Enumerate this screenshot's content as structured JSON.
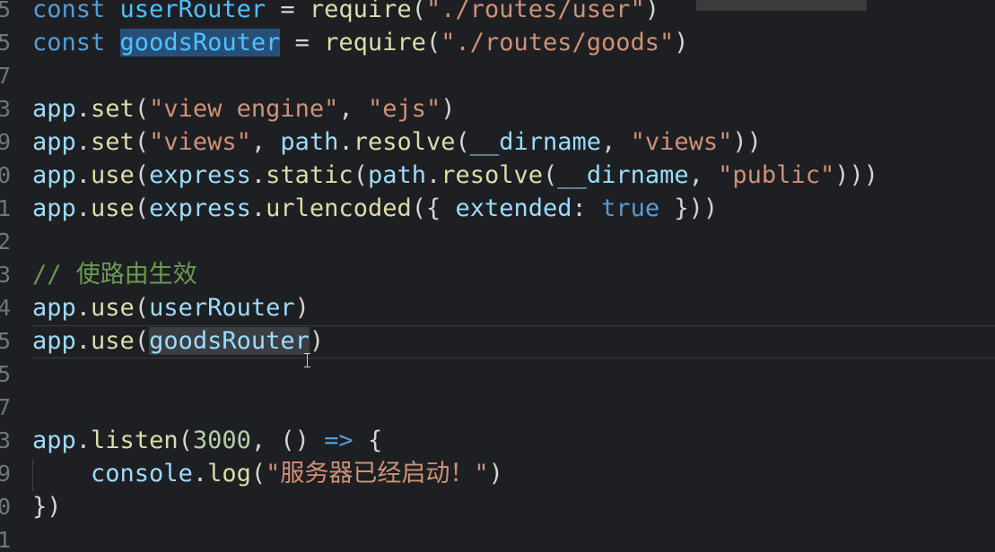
{
  "editor": {
    "gutter_numbers": [
      "5",
      "5",
      "7",
      "3",
      "9",
      "0",
      "1",
      "2",
      "3",
      "4",
      "5",
      "5",
      "7",
      "3",
      "9",
      "0",
      "1"
    ],
    "lines": [
      [
        {
          "t": "const ",
          "c": "kw"
        },
        {
          "t": "userRouter",
          "c": "var"
        },
        {
          "t": " = ",
          "c": "punc"
        },
        {
          "t": "require",
          "c": "fn"
        },
        {
          "t": "(",
          "c": "punc"
        },
        {
          "t": "\"./routes/user\"",
          "c": "str"
        },
        {
          "t": ")",
          "c": "punc"
        }
      ],
      [
        {
          "t": "const ",
          "c": "kw"
        },
        {
          "t": "goodsRouter",
          "c": "var hl-word"
        },
        {
          "t": " = ",
          "c": "punc"
        },
        {
          "t": "require",
          "c": "fn"
        },
        {
          "t": "(",
          "c": "punc"
        },
        {
          "t": "\"./routes/goods\"",
          "c": "str"
        },
        {
          "t": ")",
          "c": "punc"
        }
      ],
      [],
      [
        {
          "t": "app",
          "c": "obj"
        },
        {
          "t": ".",
          "c": "punc"
        },
        {
          "t": "set",
          "c": "fn"
        },
        {
          "t": "(",
          "c": "punc"
        },
        {
          "t": "\"view engine\"",
          "c": "str"
        },
        {
          "t": ", ",
          "c": "punc"
        },
        {
          "t": "\"ejs\"",
          "c": "str"
        },
        {
          "t": ")",
          "c": "punc"
        }
      ],
      [
        {
          "t": "app",
          "c": "obj"
        },
        {
          "t": ".",
          "c": "punc"
        },
        {
          "t": "set",
          "c": "fn"
        },
        {
          "t": "(",
          "c": "punc"
        },
        {
          "t": "\"views\"",
          "c": "str"
        },
        {
          "t": ", ",
          "c": "punc"
        },
        {
          "t": "path",
          "c": "obj"
        },
        {
          "t": ".",
          "c": "punc"
        },
        {
          "t": "resolve",
          "c": "fn"
        },
        {
          "t": "(",
          "c": "punc"
        },
        {
          "t": "__dirname",
          "c": "obj"
        },
        {
          "t": ", ",
          "c": "punc"
        },
        {
          "t": "\"views\"",
          "c": "str"
        },
        {
          "t": "))",
          "c": "punc"
        }
      ],
      [
        {
          "t": "app",
          "c": "obj"
        },
        {
          "t": ".",
          "c": "punc"
        },
        {
          "t": "use",
          "c": "fn"
        },
        {
          "t": "(",
          "c": "punc"
        },
        {
          "t": "express",
          "c": "obj"
        },
        {
          "t": ".",
          "c": "punc"
        },
        {
          "t": "static",
          "c": "fn"
        },
        {
          "t": "(",
          "c": "punc"
        },
        {
          "t": "path",
          "c": "obj"
        },
        {
          "t": ".",
          "c": "punc"
        },
        {
          "t": "resolve",
          "c": "fn"
        },
        {
          "t": "(",
          "c": "punc"
        },
        {
          "t": "__dirname",
          "c": "obj"
        },
        {
          "t": ", ",
          "c": "punc"
        },
        {
          "t": "\"public\"",
          "c": "str"
        },
        {
          "t": ")))",
          "c": "punc"
        }
      ],
      [
        {
          "t": "app",
          "c": "obj"
        },
        {
          "t": ".",
          "c": "punc"
        },
        {
          "t": "use",
          "c": "fn"
        },
        {
          "t": "(",
          "c": "punc"
        },
        {
          "t": "express",
          "c": "obj"
        },
        {
          "t": ".",
          "c": "punc"
        },
        {
          "t": "urlencoded",
          "c": "fn"
        },
        {
          "t": "({ ",
          "c": "punc"
        },
        {
          "t": "extended",
          "c": "obj"
        },
        {
          "t": ": ",
          "c": "punc"
        },
        {
          "t": "true",
          "c": "bool"
        },
        {
          "t": " }))",
          "c": "punc"
        }
      ],
      [],
      [
        {
          "t": "// 使路由生效",
          "c": "cmt"
        }
      ],
      [
        {
          "t": "app",
          "c": "obj"
        },
        {
          "t": ".",
          "c": "punc"
        },
        {
          "t": "use",
          "c": "fn"
        },
        {
          "t": "(",
          "c": "punc"
        },
        {
          "t": "userRouter",
          "c": "obj"
        },
        {
          "t": ")",
          "c": "punc"
        }
      ],
      [
        {
          "t": "app",
          "c": "obj"
        },
        {
          "t": ".",
          "c": "punc"
        },
        {
          "t": "use",
          "c": "fn"
        },
        {
          "t": "(",
          "c": "punc"
        },
        {
          "t": "goodsRouter",
          "c": "obj hl-sel"
        },
        {
          "t": ")",
          "c": "punc"
        }
      ],
      [],
      [],
      [
        {
          "t": "app",
          "c": "obj"
        },
        {
          "t": ".",
          "c": "punc"
        },
        {
          "t": "listen",
          "c": "fn"
        },
        {
          "t": "(",
          "c": "punc"
        },
        {
          "t": "3000",
          "c": "num"
        },
        {
          "t": ", () ",
          "c": "punc"
        },
        {
          "t": "=>",
          "c": "arrow"
        },
        {
          "t": " {",
          "c": "punc"
        }
      ],
      [
        {
          "t": "    ",
          "c": "punc"
        },
        {
          "t": "console",
          "c": "obj"
        },
        {
          "t": ".",
          "c": "punc"
        },
        {
          "t": "log",
          "c": "fn"
        },
        {
          "t": "(",
          "c": "punc"
        },
        {
          "t": "\"服务器已经启动！\"",
          "c": "str"
        },
        {
          "t": ")",
          "c": "punc"
        }
      ],
      [
        {
          "t": "})",
          "c": "punc"
        }
      ],
      []
    ]
  }
}
